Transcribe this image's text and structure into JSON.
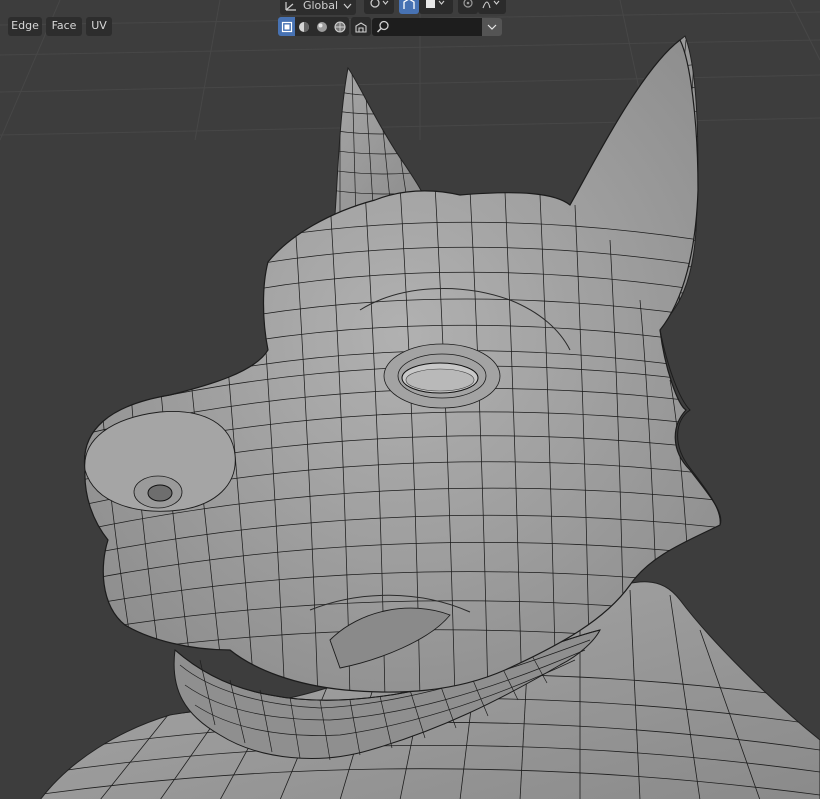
{
  "header": {
    "select_modes": [
      {
        "label": "Edge"
      },
      {
        "label": "Face"
      },
      {
        "label": "UV"
      }
    ],
    "transform_orientation": "Global",
    "search": {
      "placeholder": ""
    }
  },
  "icons": {
    "orientation": "orientation-axes-icon",
    "orientation_dropdown": "chevron-down-icon",
    "pivot": "pivot-point-icon",
    "snap": "snap-icon",
    "proportional": "proportional-edit-icon",
    "view_object_types": "view-object-types-icon",
    "overlays": "overlays-icon",
    "shading_wireframe": "wireframe-shading-icon",
    "shading_solid": "solid-shading-icon",
    "shading_material": "material-preview-icon",
    "shading_rendered": "rendered-shading-icon",
    "search": "search-icon"
  },
  "colors": {
    "background": "#3d3d3d",
    "mesh_fill": "#9d9d9d",
    "wire": "#1a1a1a",
    "active": "#4772b3"
  }
}
